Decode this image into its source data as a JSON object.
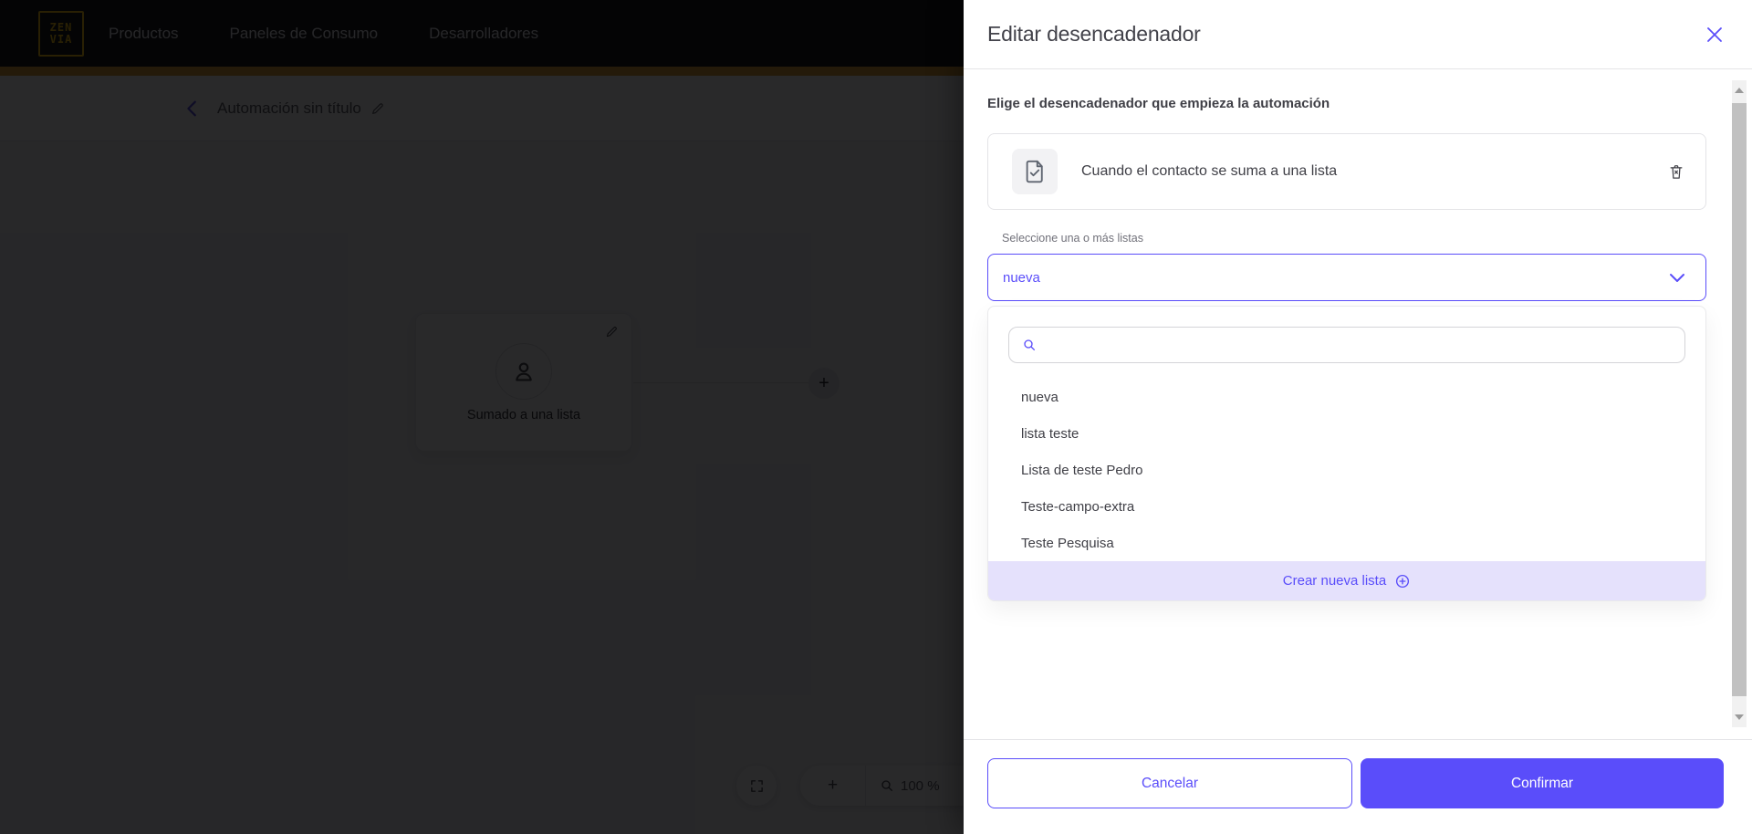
{
  "nav": {
    "logo_top": "ZEN",
    "logo_bottom": "VIA",
    "items": [
      {
        "label": "Productos"
      },
      {
        "label": "Paneles de Consumo"
      },
      {
        "label": "Desarrolladores"
      }
    ]
  },
  "toolbar": {
    "title": "Automación sin título"
  },
  "canvas": {
    "node_label": "Sumado a una lista",
    "add_symbol": "+",
    "zoom_plus": "+",
    "zoom_level": "100 %"
  },
  "panel": {
    "title": "Editar desencadenador",
    "subtitle": "Elige el desencadenador que empieza la automación",
    "trigger_card": {
      "label": "Cuando el contacto se suma a una lista"
    },
    "list_label": "Seleccione una o más listas",
    "select_value": "nueva",
    "search": {
      "value": "",
      "placeholder": ""
    },
    "options": [
      "nueva",
      "lista teste",
      "Lista de teste Pedro",
      "Teste-campo-extra",
      "Teste Pesquisa"
    ],
    "create_option": "Crear nueva lista",
    "cancel_label": "Cancelar",
    "confirm_label": "Confirmar"
  },
  "colors": {
    "accent": "#5A4DFA",
    "lavender": "#E5E1FC",
    "brand_yellow": "#FDC300",
    "promo_strip": "#DD9A2B"
  }
}
